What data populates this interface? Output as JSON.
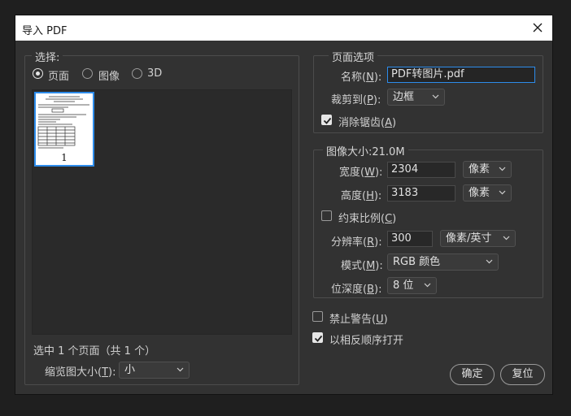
{
  "window": {
    "title": "导入 PDF"
  },
  "select_group": {
    "legend": "选择:",
    "radios": [
      {
        "label": "页面",
        "checked": true
      },
      {
        "label": "图像",
        "checked": false
      },
      {
        "label": "3D",
        "checked": false
      }
    ],
    "thumbnail_page_number": "1",
    "selection_status": "选中 1 个页面（共 1 个）",
    "thumb_size_label": "缩览图大小(",
    "thumb_size_key": "T",
    "thumb_size_value": "小"
  },
  "page_options": {
    "legend": "页面选项",
    "name_label": "名称(",
    "name_key": "N",
    "name_value": "PDF转图片.pdf",
    "crop_label": "裁剪到(",
    "crop_key": "P",
    "crop_value": "边框",
    "antialias_label": "消除锯齿(",
    "antialias_key": "A",
    "antialias_checked": true
  },
  "image_size": {
    "legend": "图像大小:21.0M",
    "width_label": "宽度(",
    "width_key": "W",
    "width_value": "2304",
    "width_unit": "像素",
    "height_label": "高度(",
    "height_key": "H",
    "height_value": "3183",
    "height_unit": "像素",
    "constrain_label": "约束比例(",
    "constrain_key": "C",
    "constrain_checked": false,
    "resolution_label": "分辨率(",
    "resolution_key": "R",
    "resolution_value": "300",
    "resolution_unit": "像素/英寸",
    "mode_label": "模式(",
    "mode_key": "M",
    "mode_value": "RGB 颜色",
    "depth_label": "位深度(",
    "depth_key": "B",
    "depth_value": "8 位"
  },
  "suppress_warnings_label": "禁止警告(",
  "suppress_warnings_key": "U",
  "suppress_warnings_checked": false,
  "reverse_order_label": "以相反顺序打开",
  "reverse_order_checked": true,
  "buttons": {
    "ok": "确定",
    "reset": "复位"
  }
}
